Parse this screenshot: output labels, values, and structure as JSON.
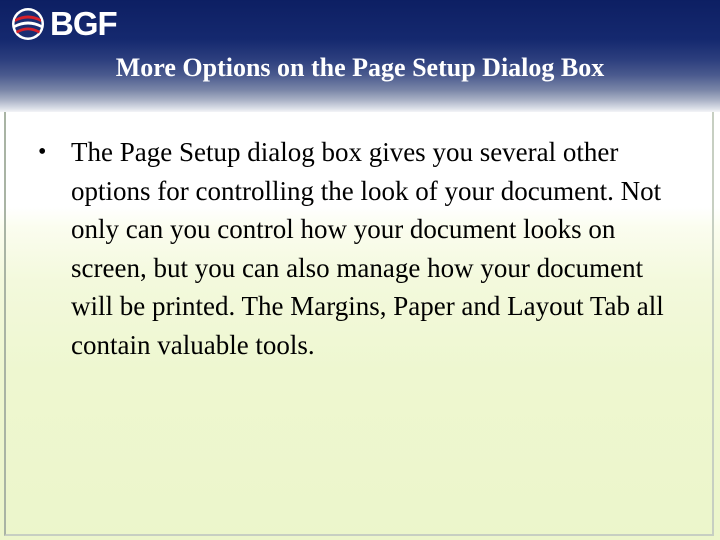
{
  "header": {
    "logo_text": "BGF",
    "logo_icon": "globe-icon",
    "title": "More Options on the Page Setup Dialog Box",
    "colors": {
      "navy": "#0d1f63",
      "content_tint": "#eef7d0"
    }
  },
  "content": {
    "bullets": [
      {
        "marker": "•",
        "text": "The Page Setup dialog box gives you several other options for controlling the look of your document. Not only can you control how your document looks on screen, but you can also manage how your document will be printed. The Margins, Paper and Layout Tab all contain valuable tools."
      }
    ]
  }
}
